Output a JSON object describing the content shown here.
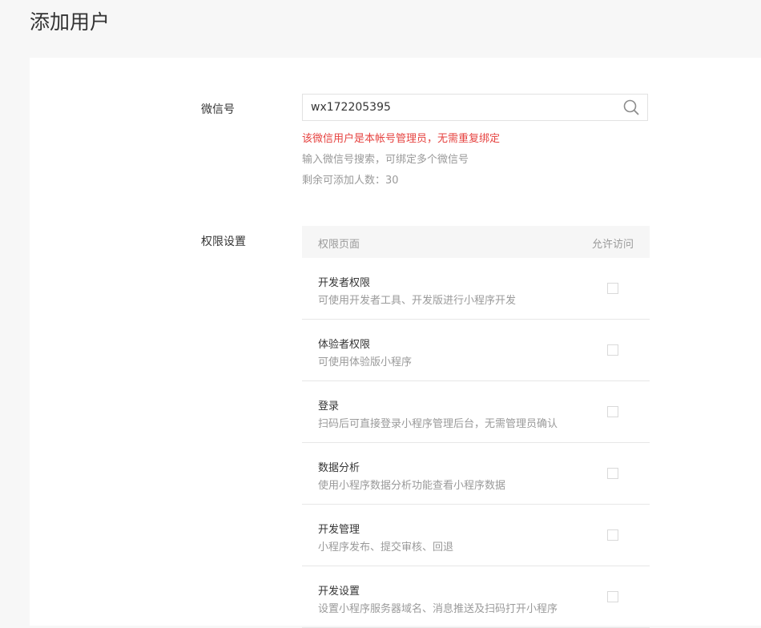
{
  "page": {
    "title": "添加用户"
  },
  "form": {
    "wechat_label": "微信号",
    "wechat_value": "wx172205395",
    "error_tip": "该微信用户是本帐号管理员，无需重复绑定",
    "hint_search": "输入微信号搜索，可绑定多个微信号",
    "hint_remaining": "剩余可添加人数：30",
    "permission_label": "权限设置"
  },
  "table": {
    "header_page": "权限页面",
    "header_allow": "允许访问",
    "rows": [
      {
        "name": "开发者权限",
        "desc": "可使用开发者工具、开发版进行小程序开发"
      },
      {
        "name": "体验者权限",
        "desc": "可使用体验版小程序"
      },
      {
        "name": "登录",
        "desc": "扫码后可直接登录小程序管理后台，无需管理员确认"
      },
      {
        "name": "数据分析",
        "desc": "使用小程序数据分析功能查看小程序数据"
      },
      {
        "name": "开发管理",
        "desc": "小程序发布、提交审核、回退"
      },
      {
        "name": "开发设置",
        "desc": "设置小程序服务器域名、消息推送及扫码打开小程序"
      }
    ]
  },
  "colors": {
    "error": "#e64340",
    "hint": "#9a9a9a",
    "text": "#353535",
    "header_bg": "#f6f6f6"
  },
  "icons": {
    "search": "search-icon",
    "checkbox": "checkbox-unchecked"
  }
}
